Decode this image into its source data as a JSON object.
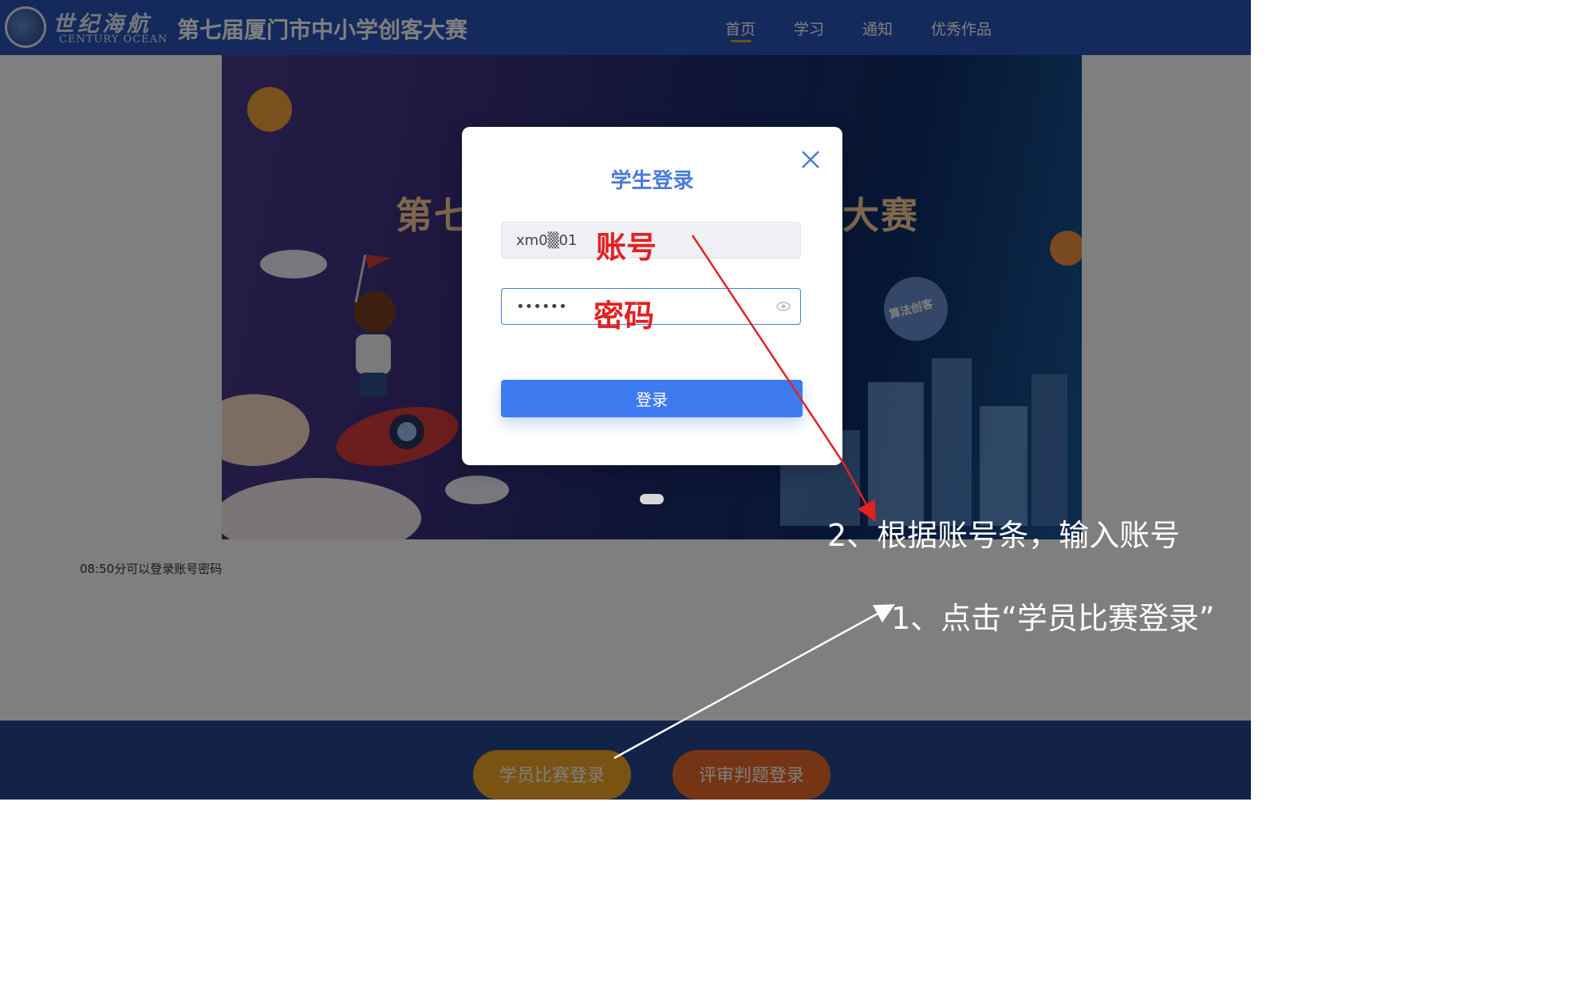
{
  "header": {
    "logo_cn": "世纪海航",
    "logo_en": "CENTURY OCEAN",
    "site_title": "第七届厦门市中小学创客大赛",
    "nav": [
      {
        "label": "首页",
        "active": true
      },
      {
        "label": "学习"
      },
      {
        "label": "通知"
      },
      {
        "label": "优秀作品"
      }
    ]
  },
  "banner": {
    "title_left": "第七",
    "title_right": "大赛",
    "badge": "算法创客"
  },
  "notice": "08:50分可以登录账号密码",
  "footer": {
    "student_login": "学员比赛登录",
    "judge_login": "评审判题登录"
  },
  "modal": {
    "title": "学生登录",
    "account_value": "xm0▒01",
    "password_value": "••••••",
    "login_button": "登录"
  },
  "annotations": {
    "account_label": "账号",
    "password_label": "密码",
    "step2": "2、根据账号条，输入账号",
    "step1": "1、点击“学员比赛登录”"
  },
  "colors": {
    "header_bg": "#2b54b8",
    "primary": "#3e7bf0",
    "annotation_red": "#e32121",
    "student_button": "#f2a625",
    "judge_button": "#ea6a2a"
  }
}
